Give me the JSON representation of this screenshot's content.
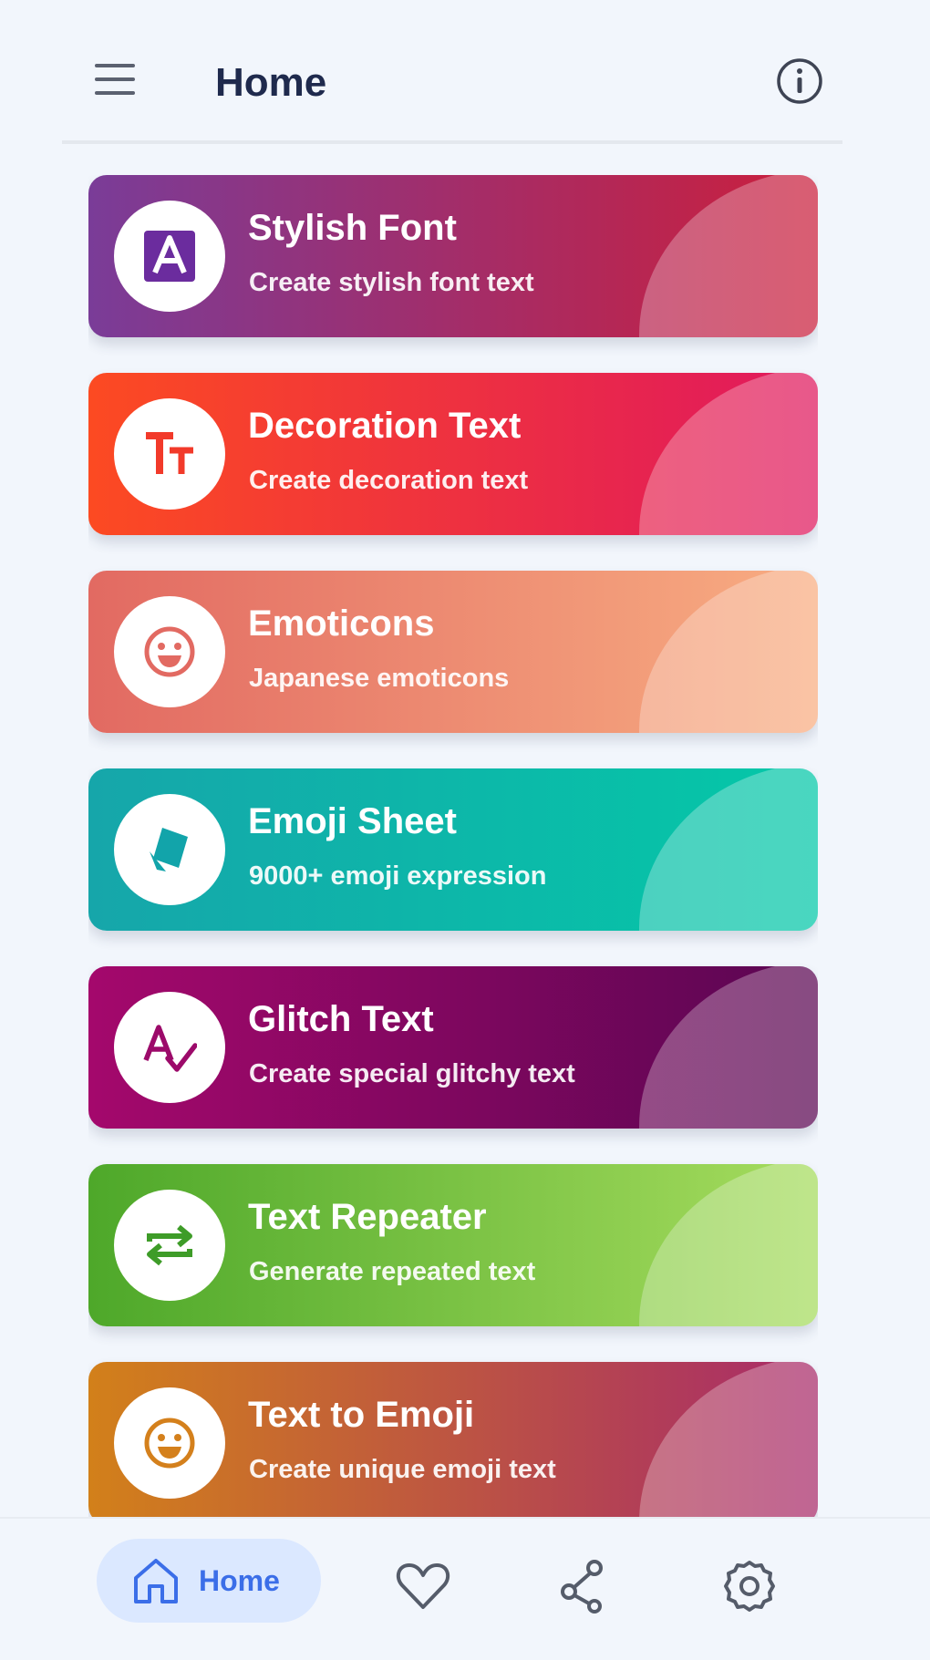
{
  "header": {
    "title": "Home"
  },
  "cards": [
    {
      "title": "Stylish Font",
      "subtitle": "Create stylish font text",
      "icon": "stylish-font-icon",
      "colors": [
        "#7a3c98",
        "#cb1f3c"
      ],
      "accent": "#6b2c9e"
    },
    {
      "title": "Decoration Text",
      "subtitle": "Create decoration text",
      "icon": "decoration-text-icon",
      "colors": [
        "#fc4a22",
        "#e0185e"
      ],
      "accent": "#f23a2a"
    },
    {
      "title": "Emoticons",
      "subtitle": "Japanese emoticons",
      "icon": "emoticon-icon",
      "colors": [
        "#e26a62",
        "#f8ad82"
      ],
      "accent": "#e26a62"
    },
    {
      "title": "Emoji Sheet",
      "subtitle": "9000+ emoji expression",
      "icon": "emoji-sheet-icon",
      "colors": [
        "#16a6aa",
        "#04c8a8"
      ],
      "accent": "#12a4aa"
    },
    {
      "title": "Glitch Text",
      "subtitle": "Create special glitchy text",
      "icon": "glitch-text-icon",
      "colors": [
        "#a4086c",
        "#5a0652"
      ],
      "accent": "#9c0a6a"
    },
    {
      "title": "Text Repeater",
      "subtitle": "Generate repeated text",
      "icon": "repeat-icon",
      "colors": [
        "#4ea82a",
        "#a6dc5e"
      ],
      "accent": "#3e9c28"
    },
    {
      "title": "Text to Emoji",
      "subtitle": "Create unique emoji text",
      "icon": "text-to-emoji-icon",
      "colors": [
        "#d2801a",
        "#a82a6a"
      ],
      "accent": "#d4801c"
    }
  ],
  "bottom_nav": {
    "items": [
      {
        "label": "Home",
        "icon": "home-icon",
        "active": true
      },
      {
        "label": "",
        "icon": "heart-icon",
        "active": false
      },
      {
        "label": "",
        "icon": "share-icon",
        "active": false
      },
      {
        "label": "",
        "icon": "gear-icon",
        "active": false
      }
    ],
    "active_color": "#3b6ee8",
    "inactive_color": "#555c6a"
  }
}
